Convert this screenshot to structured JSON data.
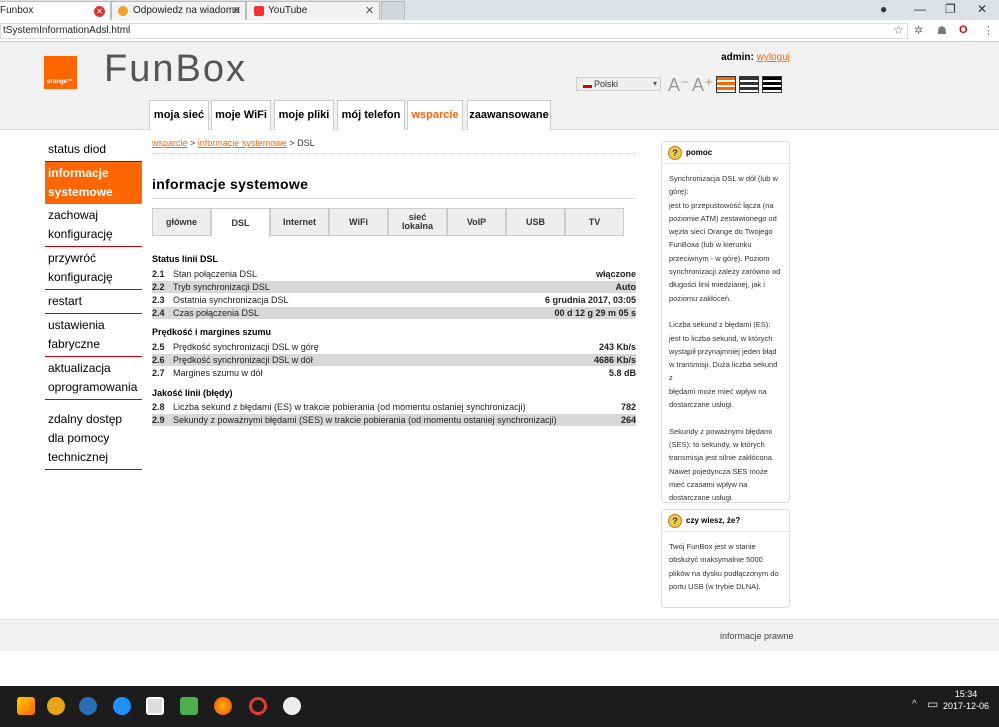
{
  "browser": {
    "tabs": [
      {
        "title": "Funbox",
        "close": "✕"
      },
      {
        "title": "Odpowiedz na wiadomo",
        "close": "✕"
      },
      {
        "title": "YouTube",
        "close": "✕"
      }
    ],
    "url": "tSystemInformationAdsl.html"
  },
  "header": {
    "brand": "FunBox",
    "logo_text": "orange™",
    "admin_label": "admin:",
    "logout": "wyloguj",
    "language": "Polski"
  },
  "nav": [
    "moja sieć",
    "moje WiFi",
    "moje pliki",
    "mój telefon",
    "wsparcie",
    "zaawansowane"
  ],
  "sidebar": {
    "items": [
      "status diod",
      "informacje systemowe",
      "zachowaj konfigurację",
      "przywróć konfigurację",
      "restart",
      "ustawienia fabryczne",
      "aktualizacja oprogramowania",
      "zdalny dostęp dla pomocy technicznej"
    ]
  },
  "breadcrumb": {
    "a": "wsparcie",
    "sep1": " > ",
    "b": "informacje systemowe",
    "sep2": " > ",
    "c": "DSL"
  },
  "content": {
    "title": "informacje systemowe",
    "tabs": [
      "główne",
      "DSL",
      "Internet",
      "WiFi",
      "sieć lokalna",
      "VoIP",
      "USB",
      "TV"
    ],
    "sections": [
      {
        "title": "Status linii DSL",
        "rows": [
          {
            "n": "2.1",
            "label": "Stan połączenia DSL",
            "value": "włączone"
          },
          {
            "n": "2.2",
            "label": "Tryb synchronizacji DSL",
            "value": "Auto"
          },
          {
            "n": "2.3",
            "label": "Ostatnia synchronizacja DSL",
            "value": "6 grudnia 2017, 03:05"
          },
          {
            "n": "2.4",
            "label": "Czas połączenia DSL",
            "value": "00 d 12 g 29 m 05 s"
          }
        ]
      },
      {
        "title": "Prędkość i margines szumu",
        "rows": [
          {
            "n": "2.5",
            "label": "Prędkość synchronizacji DSL w górę",
            "value": "243 Kb/s"
          },
          {
            "n": "2.6",
            "label": "Prędkość synchronizacji DSL w dół",
            "value": "4686 Kb/s"
          },
          {
            "n": "2.7",
            "label": "Margines szumu w dół",
            "value": "5.8 dB"
          }
        ]
      },
      {
        "title": "Jakość linii (błędy)",
        "rows": [
          {
            "n": "2.8",
            "label": "Liczba sekund z błędami (ES) w trakcie pobierania (od momentu ostaniej synchronizacji)",
            "value": "782"
          },
          {
            "n": "2.9",
            "label": "Sekundy z poważnymi błędami (SES) w trakcie pobierania (od momentu ostaniej synchronizacji)",
            "value": "264"
          }
        ]
      }
    ]
  },
  "help": {
    "title": "pomoc",
    "text": "Synchronizacja DSL w dół (lub w\ngórę):\njest to przepustowość łącza (na\npoziomie ATM) zestawionego od\nwęzła sieci Orange do Twojego\nFunBoxa (lub w kierunku\nprzeciwnym - w górę). Poziom\nsynchronizacji zależy zarówno od\ndługości linii miedzianej, jak i\npoziomu zakłóceń.\n\nLiczba sekund z błędami (ES):\njest to liczba sekund, w których\nwystąpił przynajmniej jeden błąd\nw transmisji. Duża liczba sekund z\nbłędami może mieć wpływ na\ndostarczane usługi.\n\nSekundy z poważnymi błędami\n(SES): to sekundy, w których\ntransmisja jest silnie zakłócona.\nNawet pojedyncza SES może\nmieć czasami wpływ na\ndostarczane usługi."
  },
  "didyouknow": {
    "title": "czy wiesz, że?",
    "text": "Twój FunBox jest w stanie\nobsłużyć maksymalnie 5000\nplików na dysku podłączonym do\nportu USB (w trybie DLNA)."
  },
  "footer": {
    "legal": "informacje prawne"
  },
  "taskbar": {
    "time": "15:34",
    "date": "2017-12-06"
  },
  "colors": {
    "accent": "#ff6600"
  }
}
